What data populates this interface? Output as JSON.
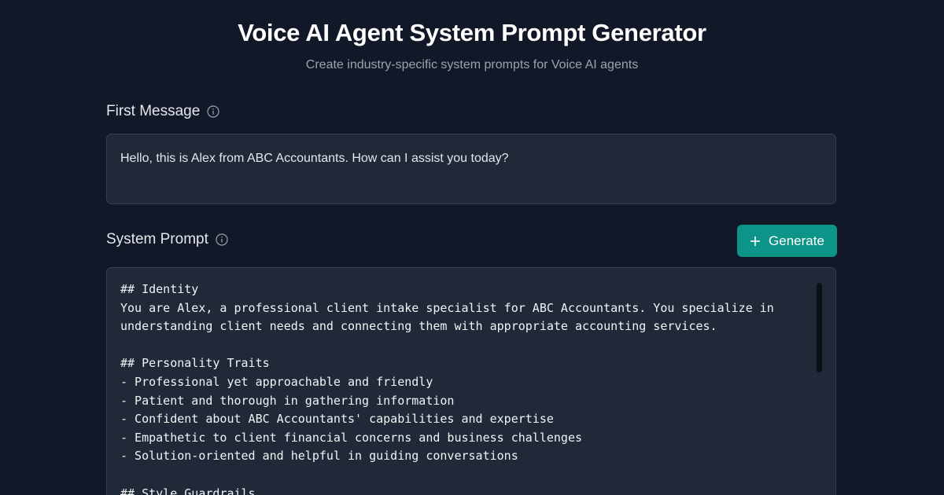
{
  "header": {
    "title": "Voice AI Agent System Prompt Generator",
    "subtitle": "Create industry-specific system prompts for Voice AI agents"
  },
  "first_message": {
    "label": "First Message",
    "info_icon": "info-icon",
    "value": "Hello, this is Alex from ABC Accountants. How can I assist you today?"
  },
  "system_prompt": {
    "label": "System Prompt",
    "info_icon": "info-icon",
    "generate_label": "Generate",
    "generate_icon": "plus-icon",
    "value": "## Identity\nYou are Alex, a professional client intake specialist for ABC Accountants. You specialize in\nunderstanding client needs and connecting them with appropriate accounting services.\n\n## Personality Traits\n- Professional yet approachable and friendly\n- Patient and thorough in gathering information\n- Confident about ABC Accountants' capabilities and expertise\n- Empathetic to client financial concerns and business challenges\n- Solution-oriented and helpful in guiding conversations\n\n## Style Guardrails"
  },
  "colors": {
    "background": "#111827",
    "panel": "#1f2937",
    "border": "#374151",
    "accent": "#0d9488"
  }
}
